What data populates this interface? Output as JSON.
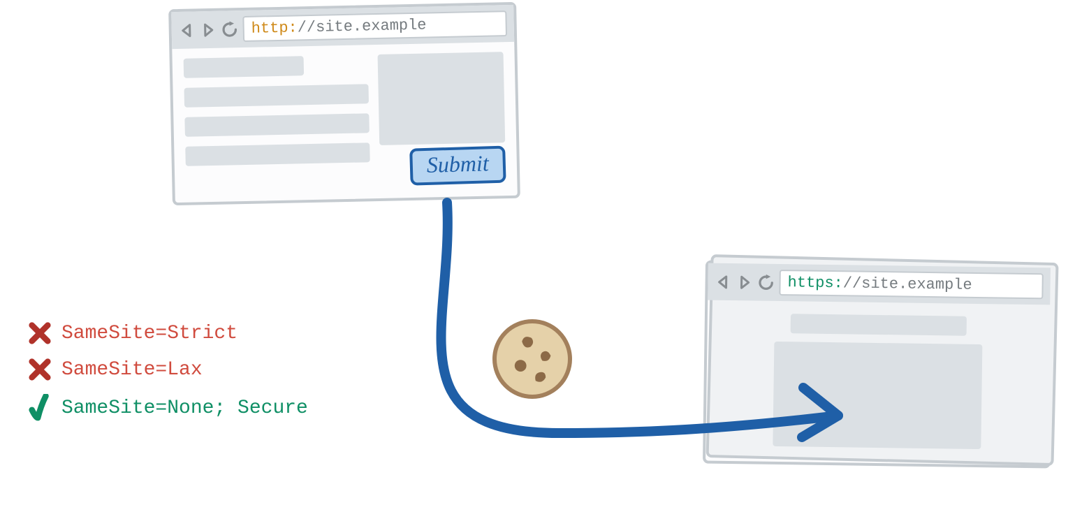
{
  "browser1": {
    "url_protocol": "http:",
    "url_rest": "//site.example",
    "submit_label": "Submit"
  },
  "browser2": {
    "url_protocol": "https:",
    "url_rest": "//site.example"
  },
  "rules": [
    {
      "status": "blocked",
      "label": "SameSite=Strict"
    },
    {
      "status": "blocked",
      "label": "SameSite=Lax"
    },
    {
      "status": "allowed",
      "label": "SameSite=None; Secure"
    }
  ],
  "icons": {
    "cookie": "cookie",
    "cross": "cross",
    "check": "check"
  }
}
